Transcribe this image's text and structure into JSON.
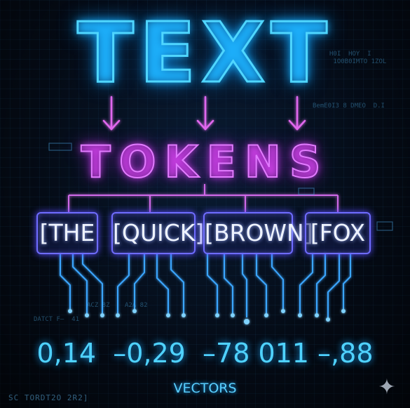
{
  "title": "TEXT",
  "subtitle": "TOKENS",
  "tokens": [
    "[THE",
    "[QUICK]",
    "[BROWN]",
    "[FOX"
  ],
  "values": "0,14  –0,29  –78 011 –,88",
  "caption": "VECTORS",
  "footer_code": "SC TORDT2O 2R2]",
  "decor_code": {
    "right_1": "H0I  HOY  I\n 1O0B0IMTO 1ZOL",
    "right_2": "BemE0I3 8 DMEO  D.I",
    "left_1": "DATCT F—  41",
    "mid_1": "ACZ 8Z",
    "mid_2": "A2A 82"
  },
  "icons": {
    "sparkle": "sparkle-icon"
  },
  "colors": {
    "title": "#4fd6ff",
    "tokens_heading": "#e27bff",
    "token_border": "#6f6cff",
    "vectors": "#4fd2ff",
    "background": "#040a14"
  }
}
